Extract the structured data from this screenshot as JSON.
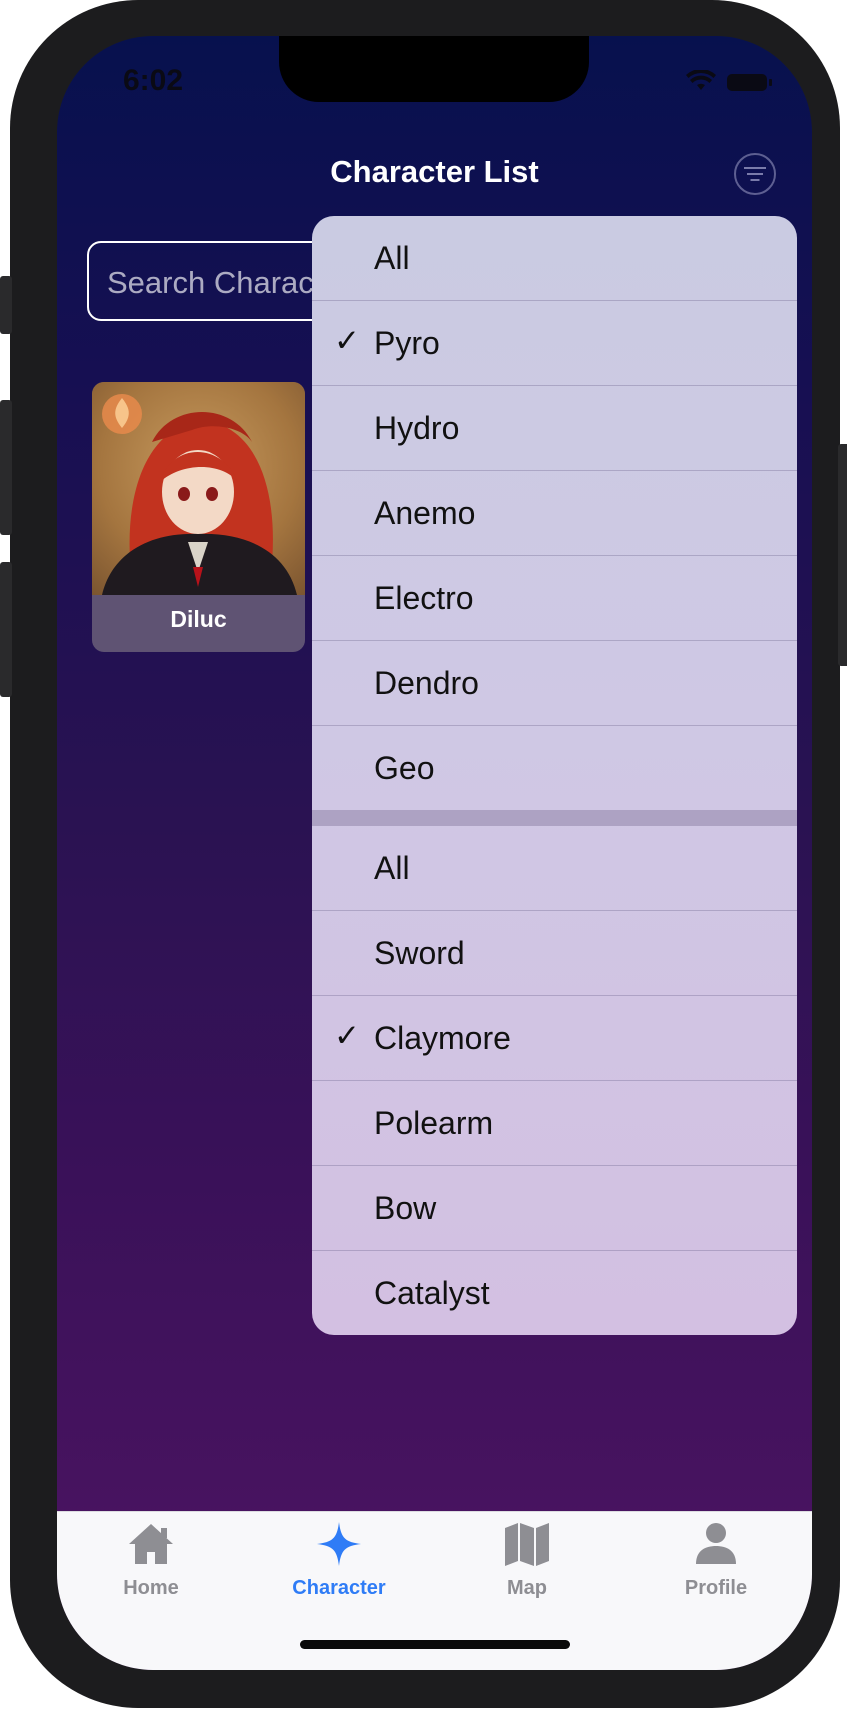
{
  "status_bar": {
    "time": "6:02"
  },
  "nav": {
    "title": "Character List",
    "filter_icon": "filter-circle-icon"
  },
  "search": {
    "placeholder": "Search Characters"
  },
  "characters": [
    {
      "name": "Diluc",
      "element_icon": "pyro-element-icon"
    }
  ],
  "filter_menu": {
    "elements": [
      {
        "label": "All",
        "checked": false
      },
      {
        "label": "Pyro",
        "checked": true
      },
      {
        "label": "Hydro",
        "checked": false
      },
      {
        "label": "Anemo",
        "checked": false
      },
      {
        "label": "Electro",
        "checked": false
      },
      {
        "label": "Dendro",
        "checked": false
      },
      {
        "label": "Geo",
        "checked": false
      }
    ],
    "weapons": [
      {
        "label": "All",
        "checked": false
      },
      {
        "label": "Sword",
        "checked": false
      },
      {
        "label": "Claymore",
        "checked": true
      },
      {
        "label": "Polearm",
        "checked": false
      },
      {
        "label": "Bow",
        "checked": false
      },
      {
        "label": "Catalyst",
        "checked": false
      }
    ],
    "check_glyph": "✓"
  },
  "tab_bar": {
    "tabs": [
      {
        "label": "Home",
        "icon": "house-icon",
        "active": false
      },
      {
        "label": "Character",
        "icon": "sparkle-icon",
        "active": true
      },
      {
        "label": "Map",
        "icon": "map-icon",
        "active": false
      },
      {
        "label": "Profile",
        "icon": "person-icon",
        "active": false
      }
    ]
  },
  "colors": {
    "accent": "#2f7cf6",
    "inactive_tab": "#8e8e93"
  }
}
